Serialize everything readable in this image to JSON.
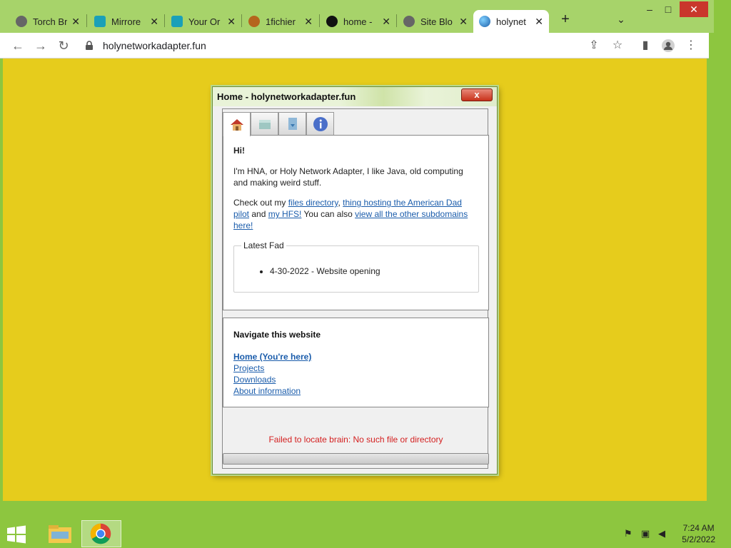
{
  "browser": {
    "tabs": [
      {
        "title": "Torch Br",
        "favicon": "globe-icon",
        "color": "#666666"
      },
      {
        "title": "Mirrore",
        "favicon": "gear-icon",
        "color": "#1aa0b8"
      },
      {
        "title": "Your Or",
        "favicon": "gear-icon",
        "color": "#1aa0b8"
      },
      {
        "title": "1fichier",
        "favicon": "hedgehog-icon",
        "color": "#b5651d"
      },
      {
        "title": "home - ",
        "favicon": "spiral-icon",
        "color": "#111111"
      },
      {
        "title": "Site Blo",
        "favicon": "globe-icon",
        "color": "#666666"
      },
      {
        "title": "holynet",
        "favicon": "globe-icon",
        "color": "#2a7fd0",
        "active": true
      }
    ],
    "url": "holynetworkadapter.fun"
  },
  "dialog": {
    "title": "Home - holynetworkadapter.fun",
    "close_label": "x",
    "home": {
      "greeting": "Hi!",
      "intro": "I'm HNA, or Holy Network Adapter, I like Java, old computing and making weird stuff.",
      "check_prefix": "Check out my ",
      "link_files": "files directory",
      "comma": ", ",
      "link_american_dad": "thing hosting the American Dad pilot",
      "and": " and ",
      "link_hfs": "my HFS!",
      "also": " You can also ",
      "link_subdomains": "view all the other subdomains here!",
      "latest_legend": "Latest Fad",
      "latest_items": [
        "4-30-2022 - Website opening"
      ]
    },
    "nav": {
      "title": "Navigate this website",
      "links": [
        "Home (You're here)",
        "Projects",
        "Downloads",
        "About information"
      ]
    },
    "error": "Failed to locate brain: No such file or directory"
  },
  "taskbar": {
    "time": "7:24 AM",
    "date": "5/2/2022"
  },
  "colors": {
    "page_bg": "#e6cc1c",
    "accent_green": "#8dc63f",
    "link": "#1a5cab",
    "error": "#d42020"
  }
}
